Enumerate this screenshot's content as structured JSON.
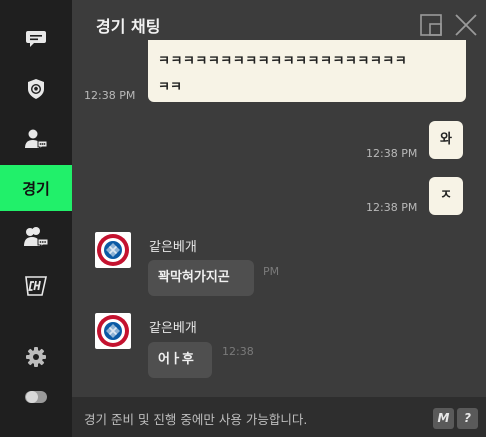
{
  "sidebar": {
    "items": [
      {
        "icon": "chat-bubble-icon"
      },
      {
        "icon": "shield-ball-icon"
      },
      {
        "icon": "user-chat-icon"
      },
      {
        "label": "경기",
        "active": true
      },
      {
        "icon": "group-chat-icon"
      },
      {
        "icon": "ch-logo-icon"
      },
      {
        "icon": "gear-icon"
      },
      {
        "icon": "toggle-icon"
      }
    ],
    "active_color": "#21f06a"
  },
  "header": {
    "title": "경기 채팅",
    "buttons": [
      "popout-icon",
      "close-icon"
    ]
  },
  "messages": [
    {
      "side": "left",
      "type": "system",
      "text_line1": "ㅋㅋㅋㅋㅋㅋㅋㅋㅋㅋㅋㅋㅋㅋㅋㅋㅋㅋㅋㅋ",
      "text_line2": "ㅋㅋ",
      "time": "12:38 PM"
    },
    {
      "side": "right",
      "text": "와",
      "time": "12:38 PM"
    },
    {
      "side": "right",
      "text": "ㅈ",
      "time": "12:38 PM"
    },
    {
      "side": "left",
      "nick": "같은베개",
      "text": "꽉막혀가지곤",
      "time": "PM"
    },
    {
      "side": "left",
      "nick": "같은베개",
      "text": "어ㅏ후",
      "time": "12:38"
    }
  ],
  "footer": {
    "notice": "경기 준비 및 진행 중에만 사용 가능합니다.",
    "btn_m": "M",
    "btn_help": "?"
  }
}
